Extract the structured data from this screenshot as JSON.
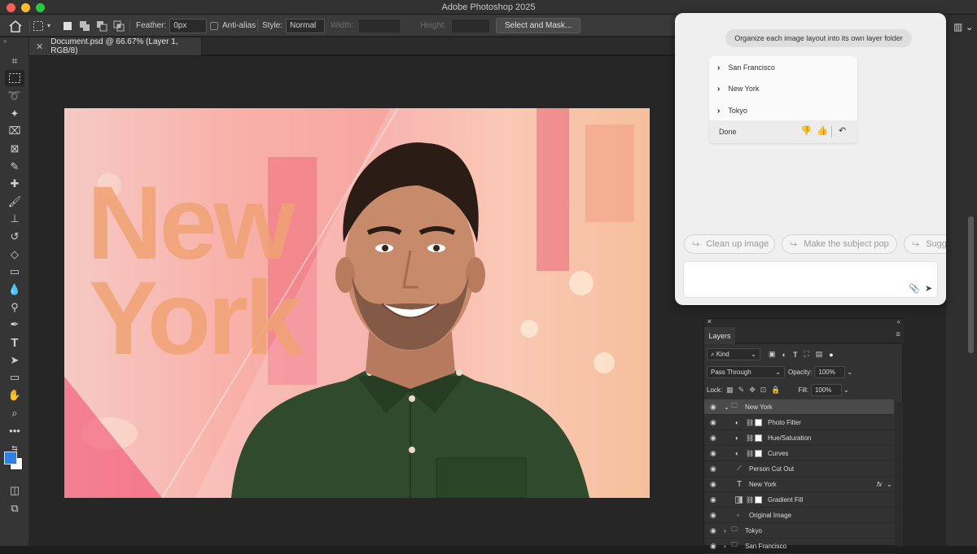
{
  "window": {
    "app_title": "Adobe Photoshop 2025"
  },
  "options_bar": {
    "feather_label": "Feather:",
    "feather_value": "0px",
    "anti_alias_label": "Anti-alias",
    "style_label": "Style:",
    "style_value": "Normal",
    "width_label": "Width:",
    "height_label": "Height:",
    "select_mask_label": "Select and Mask..."
  },
  "document_tab": {
    "title": "Document.psd @ 66.67% (Layer 1, RGB/8)"
  },
  "canvas": {
    "word_1": "New",
    "word_2": "York"
  },
  "assistant": {
    "prompt": "Organize each image layout into its own layer folder",
    "results": [
      "San Francisco",
      "New York",
      "Tokyo"
    ],
    "done_label": "Done",
    "suggestions": [
      "Clean up image",
      "Make the subject pop",
      "Sugge"
    ]
  },
  "layers_panel": {
    "tab_label": "Layers",
    "filter_kind": "Kind",
    "blend_mode": "Pass Through",
    "opacity_label": "Opacity:",
    "opacity_value": "100%",
    "lock_label": "Lock:",
    "fill_label": "Fill:",
    "fill_value": "100%",
    "layers": [
      {
        "name": "New York",
        "kind": "group-open"
      },
      {
        "name": "Photo Filter",
        "kind": "adjustment"
      },
      {
        "name": "Hue/Saturation",
        "kind": "adjustment"
      },
      {
        "name": "Curves",
        "kind": "adjustment"
      },
      {
        "name": "Person Cut Out",
        "kind": "brush"
      },
      {
        "name": "New York",
        "kind": "type",
        "fx": "fx"
      },
      {
        "name": "Gradient Fill",
        "kind": "gradient"
      },
      {
        "name": "Original Image",
        "kind": "smart"
      },
      {
        "name": "Tokyo",
        "kind": "group-closed"
      },
      {
        "name": "San Francisco",
        "kind": "group-closed"
      }
    ]
  },
  "colors": {
    "foreground": "#2d7fe0",
    "background": "#ffffff",
    "shirt": "#2f4a2c"
  }
}
